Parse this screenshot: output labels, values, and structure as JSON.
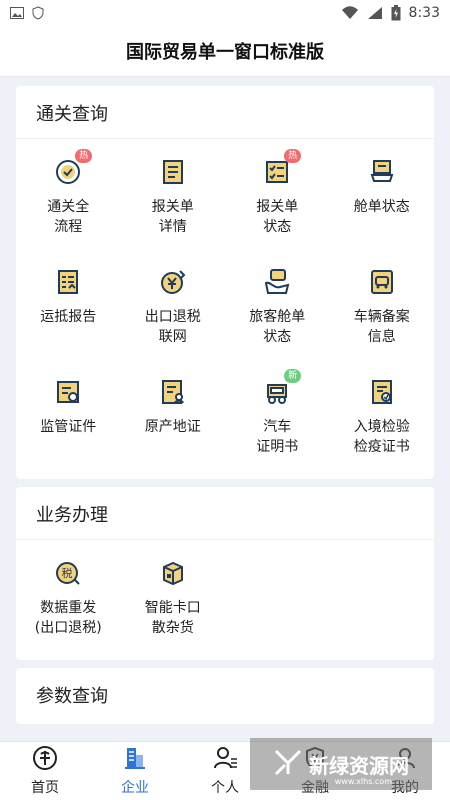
{
  "status_bar": {
    "time": "8:33"
  },
  "header": {
    "title": "国际贸易单一窗口标准版"
  },
  "customs_query": {
    "title": "通关查询",
    "items": [
      {
        "label": "通关全\n流程",
        "icon": "clock-check-icon",
        "badge": "热"
      },
      {
        "label": "报关单\n详情",
        "icon": "document-icon",
        "badge": ""
      },
      {
        "label": "报关单\n状态",
        "icon": "checklist-icon",
        "badge": "热"
      },
      {
        "label": "舱单状态",
        "icon": "cabin-icon",
        "badge": ""
      },
      {
        "label": "运抵报告",
        "icon": "report-icon",
        "badge": ""
      },
      {
        "label": "出口退税\n联网",
        "icon": "yen-refund-icon",
        "badge": ""
      },
      {
        "label": "旅客舱单\n状态",
        "icon": "passenger-icon",
        "badge": ""
      },
      {
        "label": "车辆备案\n信息",
        "icon": "vehicle-record-icon",
        "badge": ""
      },
      {
        "label": "监管证件",
        "icon": "certificate-icon",
        "badge": ""
      },
      {
        "label": "原产地证",
        "icon": "origin-cert-icon",
        "badge": ""
      },
      {
        "label": "汽车\n证明书",
        "icon": "car-icon",
        "badge": "新"
      },
      {
        "label": "入境检验\n检疫证书",
        "icon": "inspection-icon",
        "badge": ""
      }
    ]
  },
  "business": {
    "title": "业务办理",
    "items": [
      {
        "label": "数据重发\n(出口退税)",
        "icon": "tax-icon"
      },
      {
        "label": "智能卡口\n散杂货",
        "icon": "cargo-icon"
      }
    ]
  },
  "params": {
    "title": "参数查询"
  },
  "bottom_nav": [
    {
      "label": "首页",
      "icon": "home-icon",
      "active": false
    },
    {
      "label": "企业",
      "icon": "enterprise-icon",
      "active": true
    },
    {
      "label": "个人",
      "icon": "person-icon",
      "active": false
    },
    {
      "label": "金融",
      "icon": "finance-icon",
      "active": false
    },
    {
      "label": "我的",
      "icon": "profile-icon",
      "active": false
    }
  ],
  "watermark": {
    "text": "新绿资源网",
    "sub": "www.xlhs.com"
  },
  "colors": {
    "accent": "#2f72d8",
    "icon_primary": "#1f3c5a",
    "icon_accent": "#e9b94a",
    "hot": "#f36b6b",
    "new": "#6ccf7f"
  }
}
